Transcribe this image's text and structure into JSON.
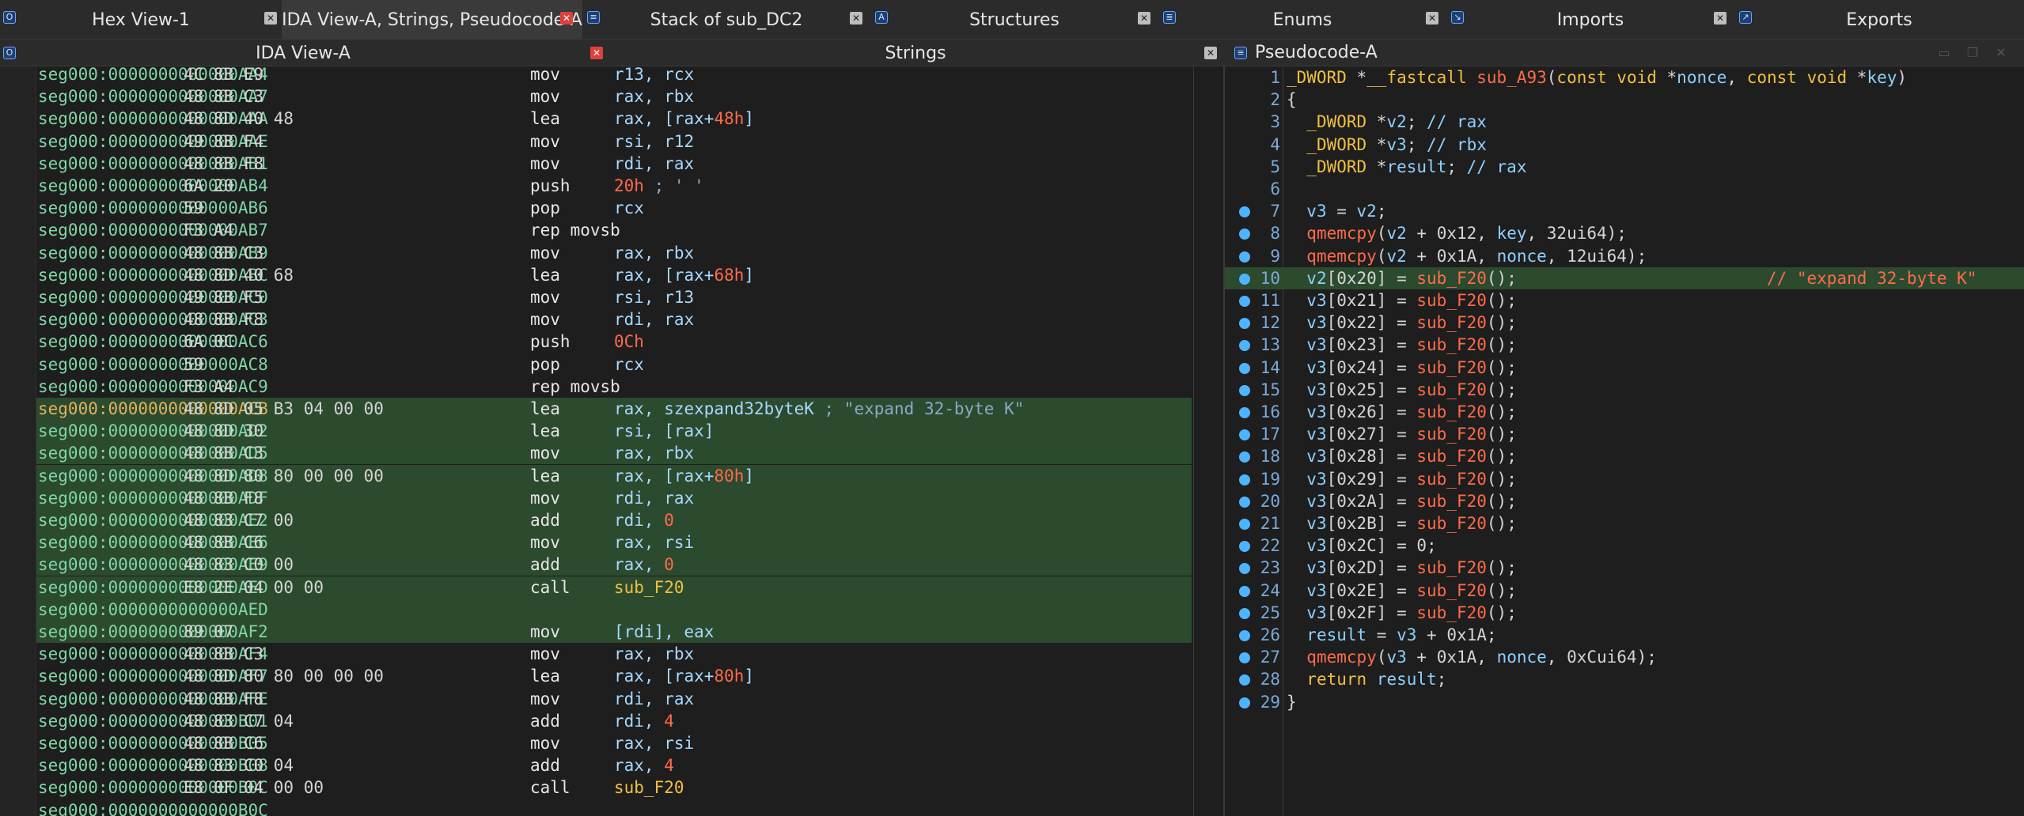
{
  "tabs": [
    {
      "label": "Hex View-1",
      "icon": "hex-icon"
    },
    {
      "label": "IDA View-A, Strings, Pseudocode-A",
      "icon": "ida-icon"
    },
    {
      "label": "Stack of sub_DC2",
      "icon": "stack-icon"
    },
    {
      "label": "Structures",
      "icon": "structures-icon"
    },
    {
      "label": "Enums",
      "icon": "enums-icon"
    },
    {
      "label": "Imports",
      "icon": "imports-icon"
    },
    {
      "label": "Exports",
      "icon": "exports-icon"
    }
  ],
  "panes": {
    "ida_title": "IDA View-A",
    "strings_title": "Strings",
    "pseudo_title": "Pseudocode-A"
  },
  "asm": [
    {
      "addr": "seg000:0000000000000AA4",
      "bytes": "4C 8B E9",
      "mnem": "mov",
      "ops": "r13, rcx"
    },
    {
      "addr": "seg000:0000000000000AA7",
      "bytes": "48 8B C3",
      "mnem": "mov",
      "ops": "rax, rbx"
    },
    {
      "addr": "seg000:0000000000000AAA",
      "bytes": "48 8D 40 48",
      "mnem": "lea",
      "ops": "rax, [rax+48h]"
    },
    {
      "addr": "seg000:0000000000000AAE",
      "bytes": "49 8B F4",
      "mnem": "mov",
      "ops": "rsi, r12"
    },
    {
      "addr": "seg000:0000000000000AB1",
      "bytes": "48 8B F8",
      "mnem": "mov",
      "ops": "rdi, rax"
    },
    {
      "addr": "seg000:0000000000000AB4",
      "bytes": "6A 20",
      "mnem": "push",
      "ops": "20h ; ' '"
    },
    {
      "addr": "seg000:0000000000000AB6",
      "bytes": "59",
      "mnem": "pop",
      "ops": "rcx"
    },
    {
      "addr": "seg000:0000000000000AB7",
      "bytes": "F3 A4",
      "mnem": "rep movsb",
      "ops": ""
    },
    {
      "addr": "seg000:0000000000000AB9",
      "bytes": "48 8B C3",
      "mnem": "mov",
      "ops": "rax, rbx"
    },
    {
      "addr": "seg000:0000000000000ABC",
      "bytes": "48 8D 40 68",
      "mnem": "lea",
      "ops": "rax, [rax+68h]"
    },
    {
      "addr": "seg000:0000000000000AC0",
      "bytes": "49 8B F5",
      "mnem": "mov",
      "ops": "rsi, r13"
    },
    {
      "addr": "seg000:0000000000000AC3",
      "bytes": "48 8B F8",
      "mnem": "mov",
      "ops": "rdi, rax"
    },
    {
      "addr": "seg000:0000000000000AC6",
      "bytes": "6A 0C",
      "mnem": "push",
      "ops": "0Ch"
    },
    {
      "addr": "seg000:0000000000000AC8",
      "bytes": "59",
      "mnem": "pop",
      "ops": "rcx"
    },
    {
      "addr": "seg000:0000000000000AC9",
      "bytes": "F3 A4",
      "mnem": "rep movsb",
      "ops": ""
    },
    {
      "addr": "seg000:0000000000000ACB",
      "bytes": "48 8D 05 B3 04 00 00",
      "mnem": "lea",
      "ops": "rax, szexpand32byteK ; \"expand 32-byte K\""
    },
    {
      "addr": "seg000:0000000000000AD2",
      "bytes": "48 8D 30",
      "mnem": "lea",
      "ops": "rsi, [rax]"
    },
    {
      "addr": "seg000:0000000000000AD5",
      "bytes": "48 8B C3",
      "mnem": "mov",
      "ops": "rax, rbx"
    },
    {
      "addr": "seg000:0000000000000AD8",
      "bytes": "48 8D 80 80 00 00 00",
      "mnem": "lea",
      "ops": "rax, [rax+80h]"
    },
    {
      "addr": "seg000:0000000000000ADF",
      "bytes": "48 8B F8",
      "mnem": "mov",
      "ops": "rdi, rax"
    },
    {
      "addr": "seg000:0000000000000AE2",
      "bytes": "48 83 C7 00",
      "mnem": "add",
      "ops": "rdi, 0"
    },
    {
      "addr": "seg000:0000000000000AE6",
      "bytes": "48 8B C6",
      "mnem": "mov",
      "ops": "rax, rsi"
    },
    {
      "addr": "seg000:0000000000000AE9",
      "bytes": "48 83 C0 00",
      "mnem": "add",
      "ops": "rax, 0"
    },
    {
      "addr": "seg000:0000000000000AED",
      "bytes": "E8 2E 04 00 00",
      "mnem": "call",
      "ops": "sub_F20"
    },
    {
      "addr": "seg000:0000000000000AED",
      "bytes": "",
      "mnem": "",
      "ops": ""
    },
    {
      "addr": "seg000:0000000000000AF2",
      "bytes": "89 07",
      "mnem": "mov",
      "ops": "[rdi], eax"
    },
    {
      "addr": "seg000:0000000000000AF4",
      "bytes": "48 8B C3",
      "mnem": "mov",
      "ops": "rax, rbx"
    },
    {
      "addr": "seg000:0000000000000AF7",
      "bytes": "48 8D 80 80 00 00 00",
      "mnem": "lea",
      "ops": "rax, [rax+80h]"
    },
    {
      "addr": "seg000:0000000000000AFE",
      "bytes": "48 8B F8",
      "mnem": "mov",
      "ops": "rdi, rax"
    },
    {
      "addr": "seg000:0000000000000B01",
      "bytes": "48 83 C7 04",
      "mnem": "add",
      "ops": "rdi, 4"
    },
    {
      "addr": "seg000:0000000000000B05",
      "bytes": "48 8B C6",
      "mnem": "mov",
      "ops": "rax, rsi"
    },
    {
      "addr": "seg000:0000000000000B08",
      "bytes": "48 83 C0 04",
      "mnem": "add",
      "ops": "rax, 4"
    },
    {
      "addr": "seg000:0000000000000B0C",
      "bytes": "E8 0F 04 00 00",
      "mnem": "call",
      "ops": "sub_F20"
    },
    {
      "addr": "seg000:0000000000000B0C",
      "bytes": "",
      "mnem": "",
      "ops": ""
    }
  ],
  "pseudocode": [
    "_DWORD *__fastcall sub_A93(const void *nonce, const void *key)",
    "{",
    "  _DWORD *v2; // rax",
    "  _DWORD *v3; // rbx",
    "  _DWORD *result; // rax",
    "",
    "  v3 = v2;",
    "  qmemcpy(v2 + 0x12, key, 32ui64);",
    "  qmemcpy(v2 + 0x1A, nonce, 12ui64);",
    "  v2[0x20] = sub_F20();                         // \"expand 32-byte K\"",
    "  v3[0x21] = sub_F20();",
    "  v3[0x22] = sub_F20();",
    "  v3[0x23] = sub_F20();",
    "  v3[0x24] = sub_F20();",
    "  v3[0x25] = sub_F20();",
    "  v3[0x26] = sub_F20();",
    "  v3[0x27] = sub_F20();",
    "  v3[0x28] = sub_F20();",
    "  v3[0x29] = sub_F20();",
    "  v3[0x2A] = sub_F20();",
    "  v3[0x2B] = sub_F20();",
    "  v3[0x2C] = 0;",
    "  v3[0x2D] = sub_F20();",
    "  v3[0x2E] = sub_F20();",
    "  v3[0x2F] = sub_F20();",
    "  result = v3 + 0x1A;",
    "  qmemcpy(v3 + 0x1A, nonce, 0xCui64);",
    "  return result;",
    "}"
  ],
  "line_numbers": [
    "1",
    "2",
    "3",
    "4",
    "5",
    "6",
    "7",
    "8",
    "9",
    "10",
    "11",
    "12",
    "13",
    "14",
    "15",
    "16",
    "17",
    "18",
    "19",
    "20",
    "21",
    "22",
    "23",
    "24",
    "25",
    "26",
    "27",
    "28",
    "29"
  ],
  "colors": {
    "highlight": "#2c4a2e",
    "address": "#7fd6a6",
    "number": "#ff6b4a",
    "keyword": "#f0c040"
  }
}
